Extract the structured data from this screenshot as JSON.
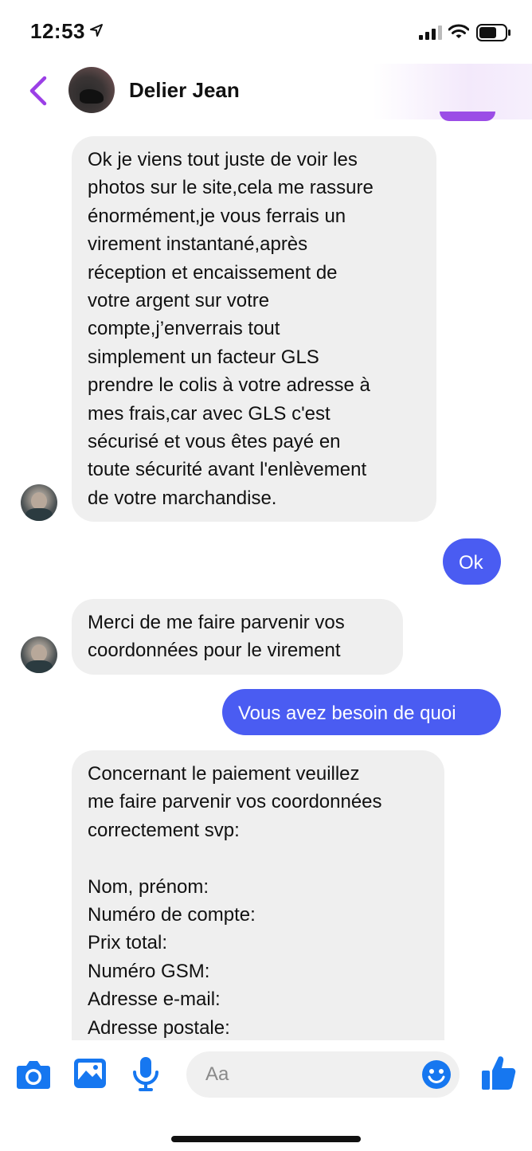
{
  "status_bar": {
    "time": "12:53"
  },
  "header": {
    "contact_name": "Delier Jean"
  },
  "messages": [
    {
      "side": "in",
      "text": "Ok je viens tout juste de voir les\nphotos sur le site,cela me rassure\nénormément,je vous ferrais un\nvirement instantané,après\nréception et encaissement de\nvotre argent sur votre\ncompte,j’enverrais tout\nsimplement un facteur GLS\nprendre le colis à votre adresse à\nmes frais,car avec GLS c'est\nsécurisé et vous êtes payé en\ntoute sécurité avant l'enlèvement\nde votre marchandise."
    },
    {
      "side": "out",
      "text": "Ok"
    },
    {
      "side": "in",
      "text": "Merci de me faire parvenir vos\ncoordonnées pour le virement"
    },
    {
      "side": "out",
      "text": "Vous avez besoin de quoi"
    },
    {
      "side": "in",
      "text": "Concernant le paiement veuillez\nme faire parvenir vos coordonnées\ncorrectement svp:\n\nNom, prénom:\nNuméro de compte:\nPrix total:\nNuméro GSM:\nAdresse e-mail:\nAdresse postale:"
    }
  ],
  "composer": {
    "placeholder": "Aa"
  },
  "colors": {
    "accent": "#4a5cf2",
    "back_arrow": "#9b3fe6",
    "icon_blue": "#1677f0",
    "incoming_bubble": "#efefef"
  },
  "icons": [
    "location-arrow-icon",
    "signal-icon",
    "wifi-icon",
    "battery-icon",
    "back-chevron-icon",
    "camera-icon",
    "gallery-icon",
    "microphone-icon",
    "emoji-icon",
    "thumbs-up-icon"
  ]
}
